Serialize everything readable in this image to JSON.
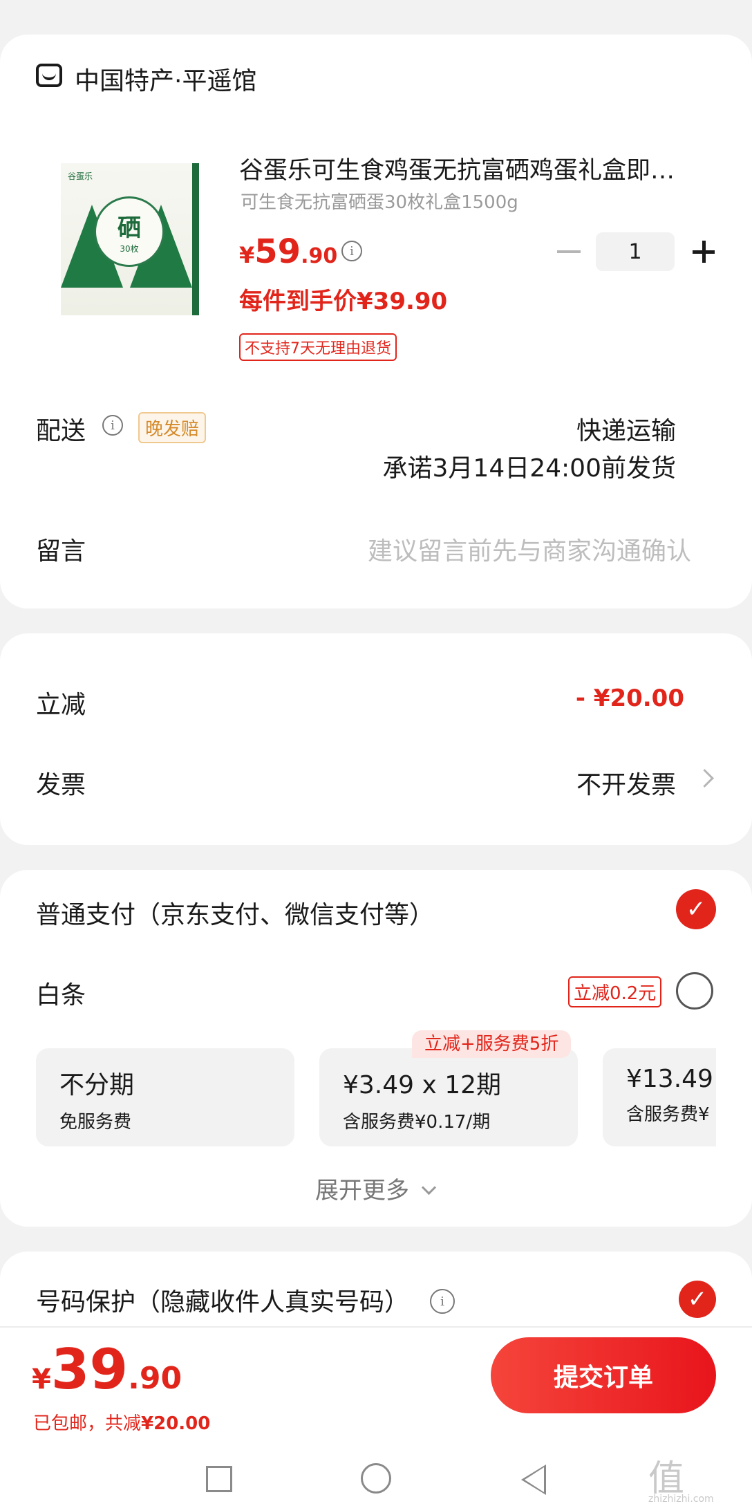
{
  "shop": {
    "name": "中国特产·平遥馆"
  },
  "product": {
    "title": "谷蛋乐可生食鸡蛋无抗富硒鸡蛋礼盒即…",
    "spec": "可生食无抗富硒蛋30枚礼盒1500g",
    "price_symbol": "¥",
    "price_int": "59",
    "price_dec": ".90",
    "final_price": "每件到手价¥39.90",
    "return_policy": "不支持7天无理由退货",
    "quantity": "1",
    "image_text": {
      "brand": "谷蛋乐",
      "big": "硒",
      "count": "30枚"
    }
  },
  "delivery": {
    "label": "配送",
    "badge": "晚发赔",
    "method": "快递运输",
    "promise": "承诺3月14日24:00前发货"
  },
  "message": {
    "label": "留言",
    "placeholder": "建议留言前先与商家沟通确认"
  },
  "discount": {
    "label": "立减",
    "value": "- ¥20.00"
  },
  "invoice": {
    "label": "发票",
    "value": "不开发票"
  },
  "payment": {
    "normal_label": "普通支付（京东支付、微信支付等）",
    "normal_selected": true,
    "baitiao_label": "白条",
    "baitiao_badge": "立减0.2元",
    "baitiao_selected": false,
    "promo_tag": "立减+服务费5折",
    "plans": [
      {
        "title": "不分期",
        "sub": "免服务费"
      },
      {
        "title": "¥3.49 x 12期",
        "sub": "含服务费¥0.17/期"
      },
      {
        "title": "¥13.49",
        "sub": "含服务费¥"
      }
    ],
    "expand_label": "展开更多"
  },
  "privacy": {
    "label": "号码保护（隐藏收件人真实号码）",
    "selected": true
  },
  "footer": {
    "price_symbol": "¥",
    "price_int": "39",
    "price_dec": ".90",
    "shipping_note": "已包邮，共减",
    "saved": "¥20.00",
    "submit_label": "提交订单"
  },
  "watermark": {
    "logo": "值",
    "site": "zhizhizhi.com"
  },
  "colors": {
    "accent": "#e1251b",
    "page_bg": "#f2f2f2",
    "badge_orange": "#d48a2a"
  }
}
